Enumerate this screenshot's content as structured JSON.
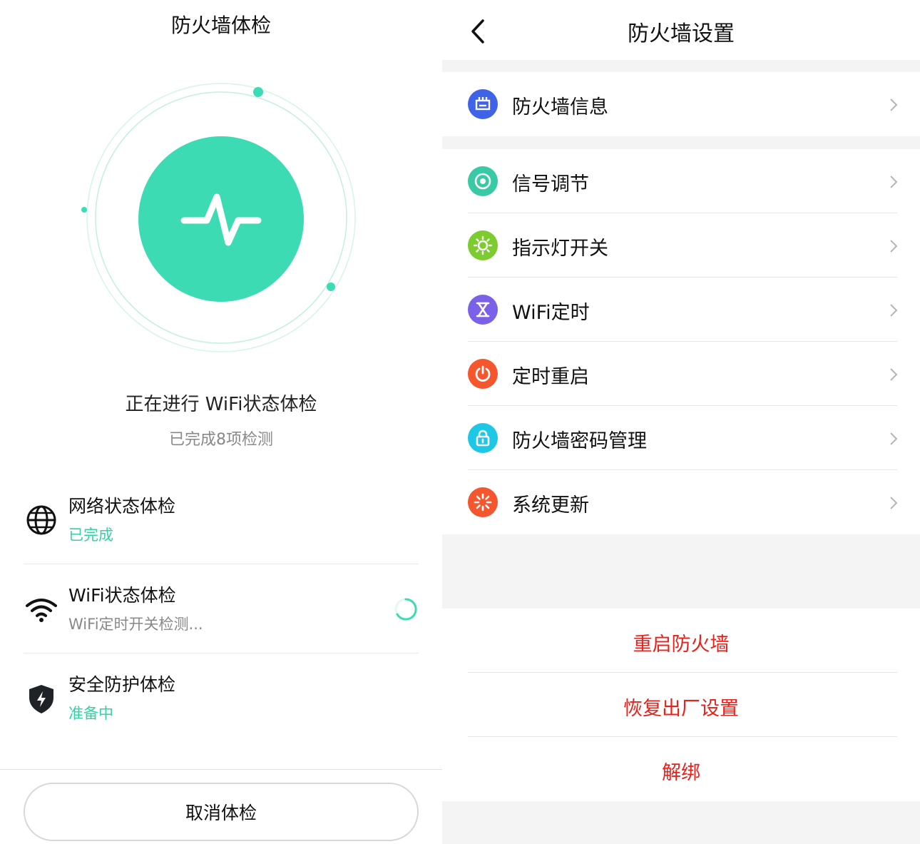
{
  "check_screen": {
    "title": "防火墙体检",
    "status_title": "正在进行 WiFi状态体检",
    "status_sub": "已完成8项检测",
    "accent_color": "#3ddbb4",
    "items": [
      {
        "icon": "globe-icon",
        "name": "网络状态体检",
        "status": "已完成"
      },
      {
        "icon": "wifi-icon",
        "name": "WiFi状态体检",
        "status": "WiFi定时开关检测..."
      },
      {
        "icon": "shield-bolt-icon",
        "name": "安全防护体检",
        "status": "准备中"
      }
    ],
    "cancel_label": "取消体检"
  },
  "settings_screen": {
    "title": "防火墙设置",
    "back_icon": "chevron-left-icon",
    "info_item": {
      "icon": "router-icon",
      "label": "防火墙信息",
      "color": "#3f63e6"
    },
    "items": [
      {
        "icon": "signal-target-icon",
        "label": "信号调节",
        "color": "#38c9a5"
      },
      {
        "icon": "sun-icon",
        "label": "指示灯开关",
        "color": "#7ccc2f"
      },
      {
        "icon": "hourglass-icon",
        "label": "WiFi定时",
        "color": "#7a61e8"
      },
      {
        "icon": "power-icon",
        "label": "定时重启",
        "color": "#f4562e"
      },
      {
        "icon": "lock-icon",
        "label": "防火墙密码管理",
        "color": "#1ec7e6"
      },
      {
        "icon": "update-spinner-icon",
        "label": "系统更新",
        "color": "#f4562e"
      }
    ],
    "actions": [
      "重启防火墙",
      "恢复出厂设置",
      "解绑"
    ],
    "action_color": "#e8221b"
  }
}
